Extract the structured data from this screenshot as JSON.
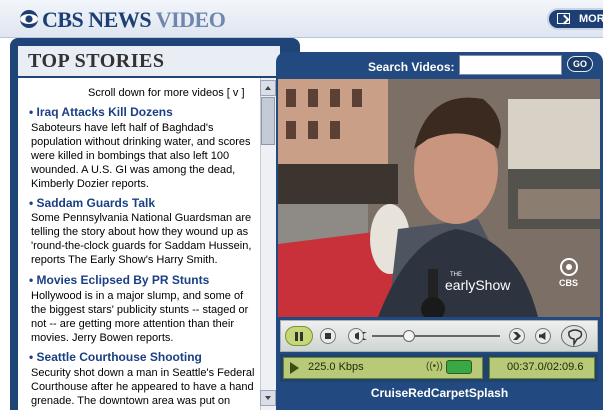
{
  "header": {
    "brand_cbs": "CBS",
    "brand_news": "NEWS",
    "brand_video": "VIDEO",
    "more_label": "MOR"
  },
  "left": {
    "section_title": "TOP STORIES",
    "scroll_hint": "Scroll down for more videos [ v ]",
    "stories": [
      {
        "title": "• Iraq Attacks Kill Dozens",
        "body": [
          "Saboteurs have left half of Baghdad's",
          "population without drinking water, and scores",
          "were killed in bombings that also left 100",
          "wounded. A U.S. GI was among the dead,",
          "Kimberly Dozier reports."
        ]
      },
      {
        "title": "• Saddam Guards Talk",
        "body": [
          "Some Pennsylvania National Guardsman are",
          "telling the story about how they wound up as",
          "'round-the-clock guards for Saddam Hussein,",
          "reports The Early Show's Harry Smith."
        ]
      },
      {
        "title": "• Movies Eclipsed By PR Stunts",
        "body": [
          "Hollywood is in a major slump, and some of",
          "the biggest stars' publicity stunts -- staged or",
          "not -- are getting more attention than their",
          "movies. Jerry Bowen reports."
        ]
      },
      {
        "title": "• Seattle Courthouse Shooting",
        "body": [
          "Security shot down a man in Seattle's Federal",
          "Courthouse after he appeared to have a hand",
          "grenade. The downtown area was put on"
        ]
      }
    ]
  },
  "player": {
    "search_label": "Search Videos:",
    "search_value": "",
    "go_label": "GO",
    "watermark_show": "earlyShow",
    "watermark_the": "THE",
    "watermark_cbs": "CBS",
    "bitrate": "225.0 Kbps",
    "signal": "((•))",
    "timecode": "00:37.0/02:09.6",
    "clip_title": "CruiseRedCarpetSplash"
  },
  "colors": {
    "navy": "#1f4478",
    "link_blue": "#1a3f85",
    "status_green": "#b8c978"
  }
}
